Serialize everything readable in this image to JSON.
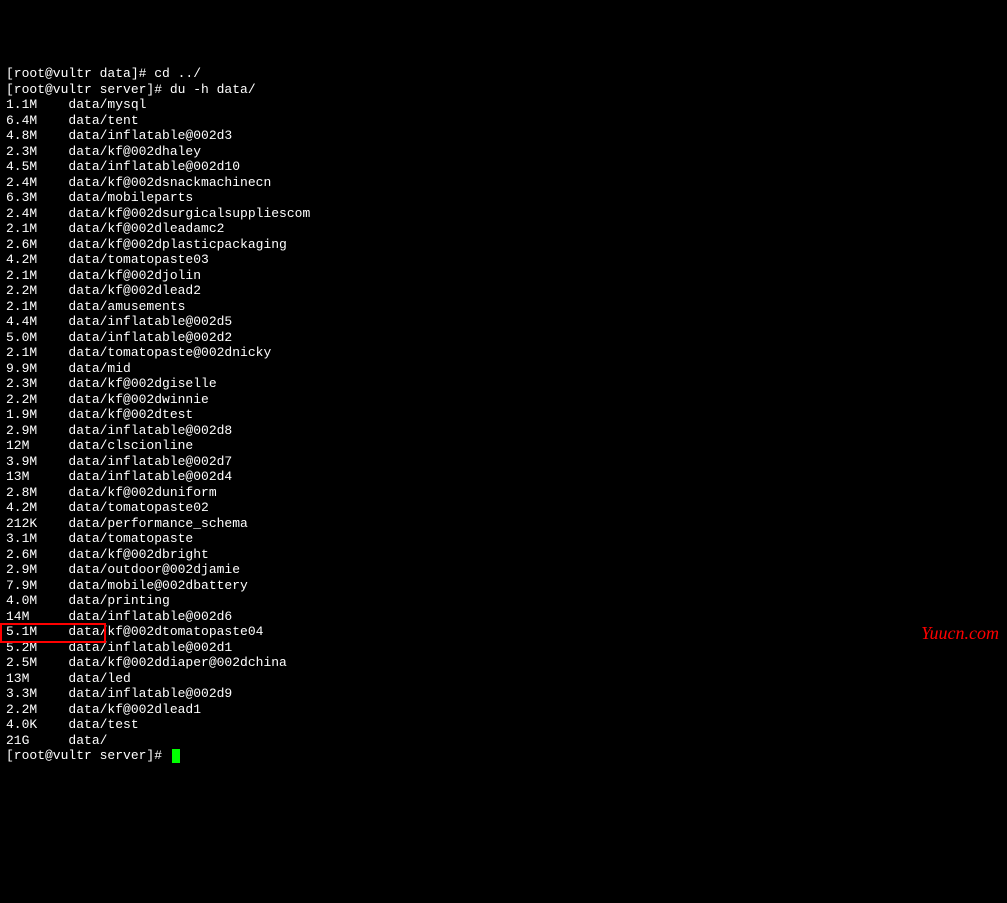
{
  "prompts": {
    "line1": "[root@vultr data]# cd ../",
    "line2": "[root@vultr server]# du -h data/",
    "final": "[root@vultr server]# "
  },
  "du_output": [
    {
      "size": "1.1M",
      "path": "data/mysql"
    },
    {
      "size": "6.4M",
      "path": "data/tent"
    },
    {
      "size": "4.8M",
      "path": "data/inflatable@002d3"
    },
    {
      "size": "2.3M",
      "path": "data/kf@002dhaley"
    },
    {
      "size": "4.5M",
      "path": "data/inflatable@002d10"
    },
    {
      "size": "2.4M",
      "path": "data/kf@002dsnackmachinecn"
    },
    {
      "size": "6.3M",
      "path": "data/mobileparts"
    },
    {
      "size": "2.4M",
      "path": "data/kf@002dsurgicalsuppliescom"
    },
    {
      "size": "2.1M",
      "path": "data/kf@002dleadamc2"
    },
    {
      "size": "2.6M",
      "path": "data/kf@002dplasticpackaging"
    },
    {
      "size": "4.2M",
      "path": "data/tomatopaste03"
    },
    {
      "size": "2.1M",
      "path": "data/kf@002djolin"
    },
    {
      "size": "2.2M",
      "path": "data/kf@002dlead2"
    },
    {
      "size": "2.1M",
      "path": "data/amusements"
    },
    {
      "size": "4.4M",
      "path": "data/inflatable@002d5"
    },
    {
      "size": "5.0M",
      "path": "data/inflatable@002d2"
    },
    {
      "size": "2.1M",
      "path": "data/tomatopaste@002dnicky"
    },
    {
      "size": "9.9M",
      "path": "data/mid"
    },
    {
      "size": "2.3M",
      "path": "data/kf@002dgiselle"
    },
    {
      "size": "2.2M",
      "path": "data/kf@002dwinnie"
    },
    {
      "size": "1.9M",
      "path": "data/kf@002dtest"
    },
    {
      "size": "2.9M",
      "path": "data/inflatable@002d8"
    },
    {
      "size": "12M",
      "path": "data/clscionline"
    },
    {
      "size": "3.9M",
      "path": "data/inflatable@002d7"
    },
    {
      "size": "13M",
      "path": "data/inflatable@002d4"
    },
    {
      "size": "2.8M",
      "path": "data/kf@002duniform"
    },
    {
      "size": "4.2M",
      "path": "data/tomatopaste02"
    },
    {
      "size": "212K",
      "path": "data/performance_schema"
    },
    {
      "size": "3.1M",
      "path": "data/tomatopaste"
    },
    {
      "size": "2.6M",
      "path": "data/kf@002dbright"
    },
    {
      "size": "2.9M",
      "path": "data/outdoor@002djamie"
    },
    {
      "size": "7.9M",
      "path": "data/mobile@002dbattery"
    },
    {
      "size": "4.0M",
      "path": "data/printing"
    },
    {
      "size": "14M",
      "path": "data/inflatable@002d6"
    },
    {
      "size": "5.1M",
      "path": "data/kf@002dtomatopaste04"
    },
    {
      "size": "5.2M",
      "path": "data/inflatable@002d1"
    },
    {
      "size": "2.5M",
      "path": "data/kf@002ddiaper@002dchina"
    },
    {
      "size": "13M",
      "path": "data/led"
    },
    {
      "size": "3.3M",
      "path": "data/inflatable@002d9"
    },
    {
      "size": "2.2M",
      "path": "data/kf@002dlead1"
    },
    {
      "size": "4.0K",
      "path": "data/test"
    },
    {
      "size": "21G",
      "path": "data/"
    }
  ],
  "watermark": "Yuucn.com"
}
